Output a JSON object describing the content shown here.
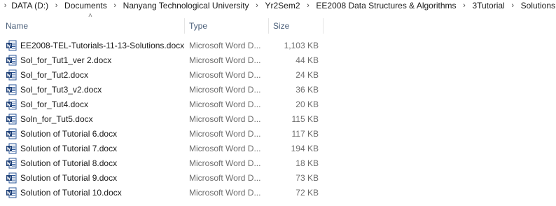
{
  "breadcrumb": {
    "items": [
      "DATA (D:)",
      "Documents",
      "Nanyang Technological University",
      "Yr2Sem2",
      "EE2008 Data Structures & Algorithms",
      "3Tutorial",
      "Solutions"
    ],
    "separator": "›"
  },
  "columns": {
    "name": "Name",
    "type": "Type",
    "size": "Size",
    "sort_indicator": "˄"
  },
  "files": [
    {
      "name": "EE2008-TEL-Tutorials-11-13-Solutions.docx",
      "type": "Microsoft Word D...",
      "size": "1,103 KB",
      "icon": "word-doc-icon"
    },
    {
      "name": "Sol_for_Tut1_ver 2.docx",
      "type": "Microsoft Word D...",
      "size": "44 KB",
      "icon": "word-doc-icon"
    },
    {
      "name": "Sol_for_Tut2.docx",
      "type": "Microsoft Word D...",
      "size": "24 KB",
      "icon": "word-doc-icon"
    },
    {
      "name": "Sol_for_Tut3_v2.docx",
      "type": "Microsoft Word D...",
      "size": "36 KB",
      "icon": "word-doc-icon"
    },
    {
      "name": "Sol_for_Tut4.docx",
      "type": "Microsoft Word D...",
      "size": "20 KB",
      "icon": "word-doc-icon"
    },
    {
      "name": "Soln_for_Tut5.docx",
      "type": "Microsoft Word D...",
      "size": "115 KB",
      "icon": "word-doc-icon"
    },
    {
      "name": "Solution of Tutorial 6.docx",
      "type": "Microsoft Word D...",
      "size": "117 KB",
      "icon": "word-doc-icon"
    },
    {
      "name": "Solution of Tutorial 7.docx",
      "type": "Microsoft Word D...",
      "size": "194 KB",
      "icon": "word-doc-icon"
    },
    {
      "name": "Solution of Tutorial 8.docx",
      "type": "Microsoft Word D...",
      "size": "18 KB",
      "icon": "word-doc-icon"
    },
    {
      "name": "Solution of Tutorial 9.docx",
      "type": "Microsoft Word D...",
      "size": "73 KB",
      "icon": "word-doc-icon"
    },
    {
      "name": "Solution of Tutorial 10.docx",
      "type": "Microsoft Word D...",
      "size": "72 KB",
      "icon": "word-doc-icon"
    }
  ],
  "colors": {
    "word_blue": "#2b579a",
    "word_blue_dark": "#1e4077",
    "header_text": "#4c607a",
    "secondary_text": "#6d6d6d"
  }
}
